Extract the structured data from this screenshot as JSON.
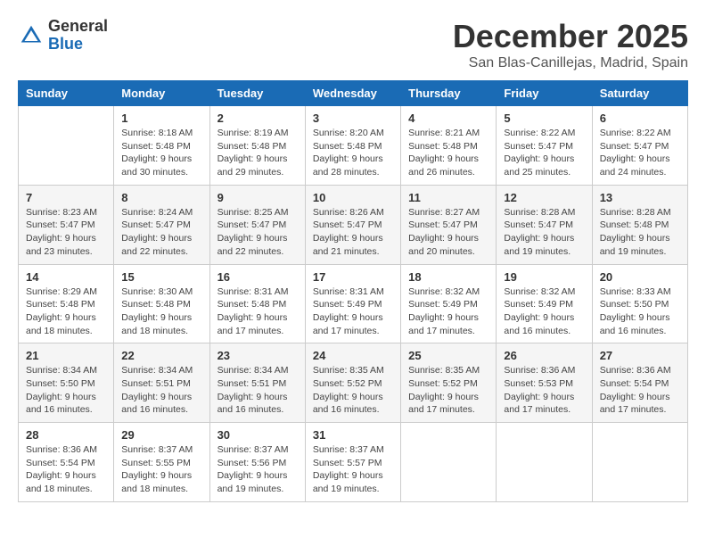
{
  "header": {
    "logo": {
      "line1": "General",
      "line2": "Blue"
    },
    "title": "December 2025",
    "subtitle": "San Blas-Canillejas, Madrid, Spain"
  },
  "calendar": {
    "days_of_week": [
      "Sunday",
      "Monday",
      "Tuesday",
      "Wednesday",
      "Thursday",
      "Friday",
      "Saturday"
    ],
    "weeks": [
      [
        {
          "day": "",
          "info": ""
        },
        {
          "day": "1",
          "info": "Sunrise: 8:18 AM\nSunset: 5:48 PM\nDaylight: 9 hours\nand 30 minutes."
        },
        {
          "day": "2",
          "info": "Sunrise: 8:19 AM\nSunset: 5:48 PM\nDaylight: 9 hours\nand 29 minutes."
        },
        {
          "day": "3",
          "info": "Sunrise: 8:20 AM\nSunset: 5:48 PM\nDaylight: 9 hours\nand 28 minutes."
        },
        {
          "day": "4",
          "info": "Sunrise: 8:21 AM\nSunset: 5:48 PM\nDaylight: 9 hours\nand 26 minutes."
        },
        {
          "day": "5",
          "info": "Sunrise: 8:22 AM\nSunset: 5:47 PM\nDaylight: 9 hours\nand 25 minutes."
        },
        {
          "day": "6",
          "info": "Sunrise: 8:22 AM\nSunset: 5:47 PM\nDaylight: 9 hours\nand 24 minutes."
        }
      ],
      [
        {
          "day": "7",
          "info": "Sunrise: 8:23 AM\nSunset: 5:47 PM\nDaylight: 9 hours\nand 23 minutes."
        },
        {
          "day": "8",
          "info": "Sunrise: 8:24 AM\nSunset: 5:47 PM\nDaylight: 9 hours\nand 22 minutes."
        },
        {
          "day": "9",
          "info": "Sunrise: 8:25 AM\nSunset: 5:47 PM\nDaylight: 9 hours\nand 22 minutes."
        },
        {
          "day": "10",
          "info": "Sunrise: 8:26 AM\nSunset: 5:47 PM\nDaylight: 9 hours\nand 21 minutes."
        },
        {
          "day": "11",
          "info": "Sunrise: 8:27 AM\nSunset: 5:47 PM\nDaylight: 9 hours\nand 20 minutes."
        },
        {
          "day": "12",
          "info": "Sunrise: 8:28 AM\nSunset: 5:47 PM\nDaylight: 9 hours\nand 19 minutes."
        },
        {
          "day": "13",
          "info": "Sunrise: 8:28 AM\nSunset: 5:48 PM\nDaylight: 9 hours\nand 19 minutes."
        }
      ],
      [
        {
          "day": "14",
          "info": "Sunrise: 8:29 AM\nSunset: 5:48 PM\nDaylight: 9 hours\nand 18 minutes."
        },
        {
          "day": "15",
          "info": "Sunrise: 8:30 AM\nSunset: 5:48 PM\nDaylight: 9 hours\nand 18 minutes."
        },
        {
          "day": "16",
          "info": "Sunrise: 8:31 AM\nSunset: 5:48 PM\nDaylight: 9 hours\nand 17 minutes."
        },
        {
          "day": "17",
          "info": "Sunrise: 8:31 AM\nSunset: 5:49 PM\nDaylight: 9 hours\nand 17 minutes."
        },
        {
          "day": "18",
          "info": "Sunrise: 8:32 AM\nSunset: 5:49 PM\nDaylight: 9 hours\nand 17 minutes."
        },
        {
          "day": "19",
          "info": "Sunrise: 8:32 AM\nSunset: 5:49 PM\nDaylight: 9 hours\nand 16 minutes."
        },
        {
          "day": "20",
          "info": "Sunrise: 8:33 AM\nSunset: 5:50 PM\nDaylight: 9 hours\nand 16 minutes."
        }
      ],
      [
        {
          "day": "21",
          "info": "Sunrise: 8:34 AM\nSunset: 5:50 PM\nDaylight: 9 hours\nand 16 minutes."
        },
        {
          "day": "22",
          "info": "Sunrise: 8:34 AM\nSunset: 5:51 PM\nDaylight: 9 hours\nand 16 minutes."
        },
        {
          "day": "23",
          "info": "Sunrise: 8:34 AM\nSunset: 5:51 PM\nDaylight: 9 hours\nand 16 minutes."
        },
        {
          "day": "24",
          "info": "Sunrise: 8:35 AM\nSunset: 5:52 PM\nDaylight: 9 hours\nand 16 minutes."
        },
        {
          "day": "25",
          "info": "Sunrise: 8:35 AM\nSunset: 5:52 PM\nDaylight: 9 hours\nand 17 minutes."
        },
        {
          "day": "26",
          "info": "Sunrise: 8:36 AM\nSunset: 5:53 PM\nDaylight: 9 hours\nand 17 minutes."
        },
        {
          "day": "27",
          "info": "Sunrise: 8:36 AM\nSunset: 5:54 PM\nDaylight: 9 hours\nand 17 minutes."
        }
      ],
      [
        {
          "day": "28",
          "info": "Sunrise: 8:36 AM\nSunset: 5:54 PM\nDaylight: 9 hours\nand 18 minutes."
        },
        {
          "day": "29",
          "info": "Sunrise: 8:37 AM\nSunset: 5:55 PM\nDaylight: 9 hours\nand 18 minutes."
        },
        {
          "day": "30",
          "info": "Sunrise: 8:37 AM\nSunset: 5:56 PM\nDaylight: 9 hours\nand 19 minutes."
        },
        {
          "day": "31",
          "info": "Sunrise: 8:37 AM\nSunset: 5:57 PM\nDaylight: 9 hours\nand 19 minutes."
        },
        {
          "day": "",
          "info": ""
        },
        {
          "day": "",
          "info": ""
        },
        {
          "day": "",
          "info": ""
        }
      ]
    ]
  }
}
